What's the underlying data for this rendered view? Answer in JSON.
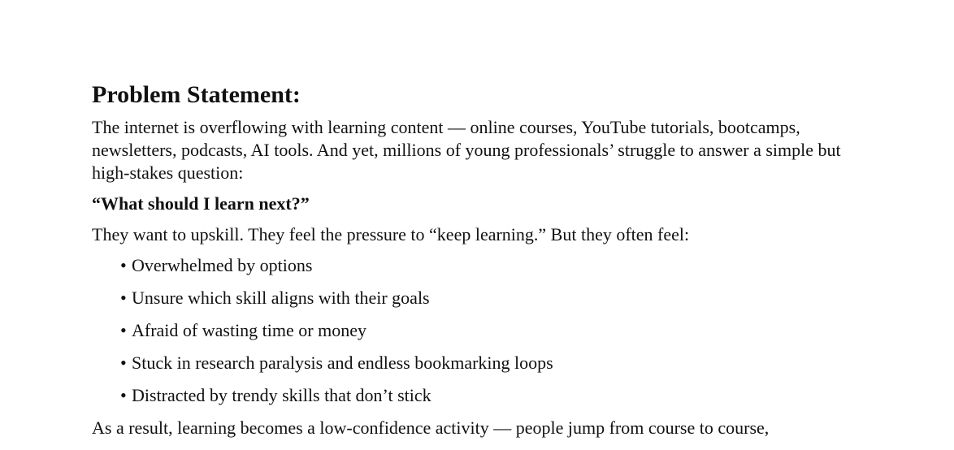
{
  "document": {
    "heading": "Problem Statement:",
    "intro": "The internet is overflowing with learning content — online courses, YouTube tutorials, bootcamps, newsletters, podcasts, AI tools. And yet, millions of young professionals’ struggle to answer a simple but high-stakes question:",
    "question": "“What should I learn next?”",
    "feel_intro": "They want to upskill. They feel the pressure to “keep learning.” But they often feel:",
    "bullet_marker": "•",
    "bullets": [
      "Overwhelmed by options",
      "Unsure which skill aligns with their goals",
      "Afraid of wasting time or money",
      "Stuck in research paralysis and endless bookmarking loops",
      "Distracted by trendy skills that don’t stick"
    ],
    "result": "As a result, learning becomes a low-confidence activity — people jump from course to course,"
  }
}
